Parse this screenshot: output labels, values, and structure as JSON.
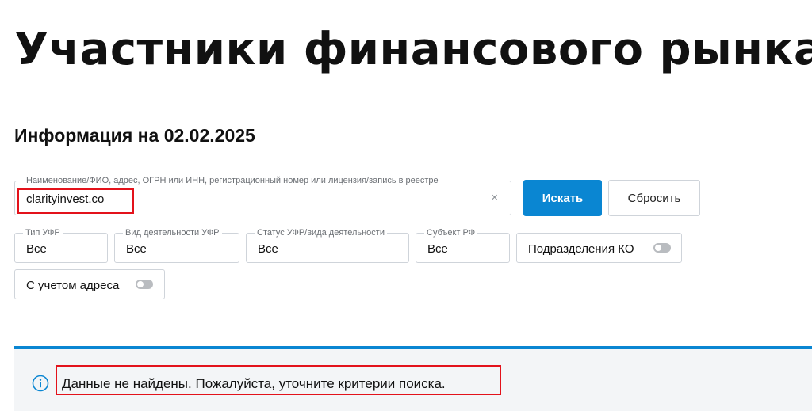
{
  "header": {
    "title": "Участники финансового рынка",
    "info_date": "Информация на 02.02.2025"
  },
  "search": {
    "legend": "Наименование/ФИО, адрес, ОГРН или ИНН, регистрационный номер или лицензия/запись в реестре",
    "value": "clarityinvest.co",
    "clear_icon": "×",
    "submit_label": "Искать",
    "reset_label": "Сбросить"
  },
  "filters": {
    "type": {
      "legend": "Тип УФР",
      "value": "Все"
    },
    "activity": {
      "legend": "Вид деятельности УФР",
      "value": "Все"
    },
    "status": {
      "legend": "Статус УФР/вида деятельности",
      "value": "Все"
    },
    "subject": {
      "legend": "Субъект РФ",
      "value": "Все"
    },
    "branches_toggle": {
      "label": "Подразделения КО",
      "on": false
    },
    "address_toggle": {
      "label": "С учетом адреса",
      "on": false
    }
  },
  "notice": {
    "icon": "info-icon",
    "message": "Данные не найдены. Пожалуйста, уточните критерии поиска."
  },
  "colors": {
    "accent": "#0a86d2",
    "highlight": "#e3121b",
    "notice_bg": "#f3f5f7"
  }
}
